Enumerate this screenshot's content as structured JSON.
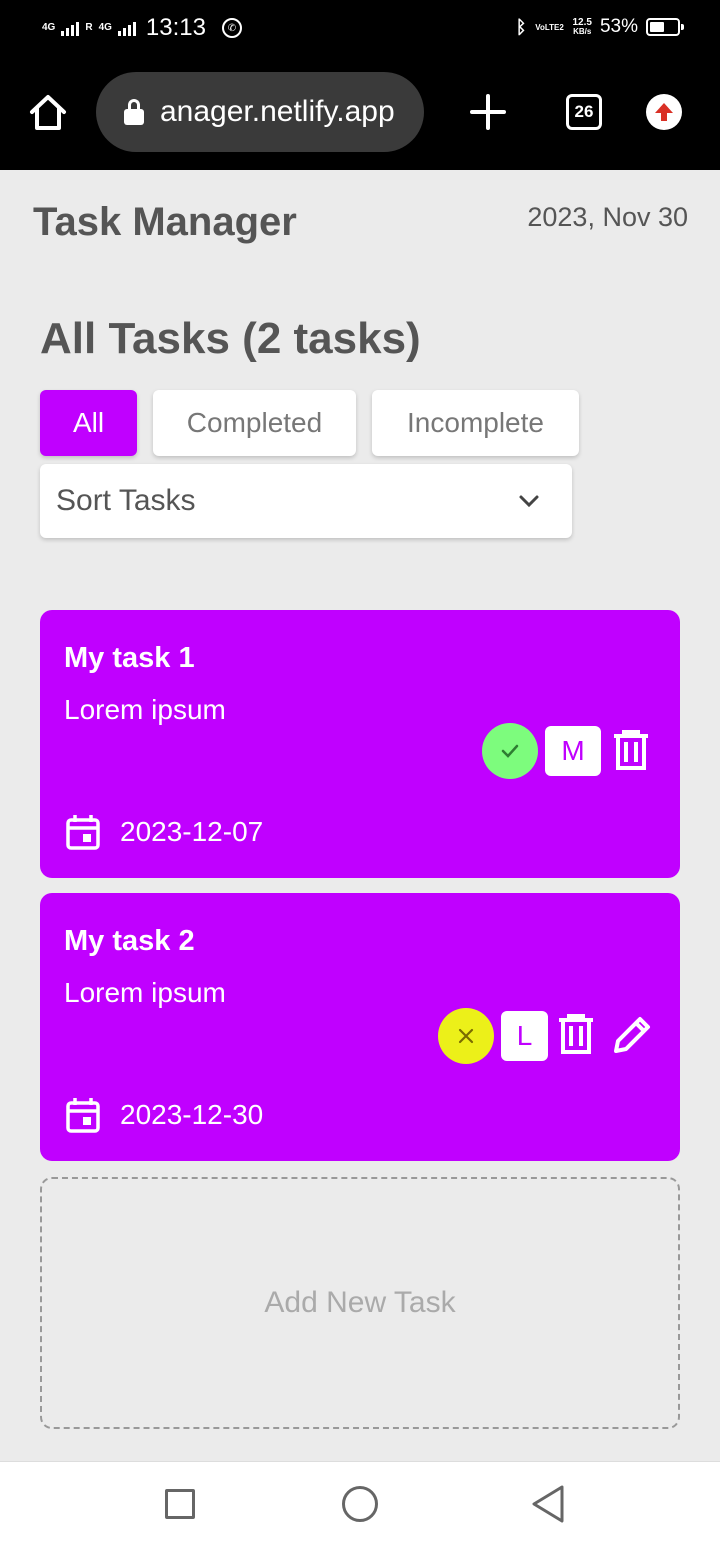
{
  "status_bar": {
    "network_left": "4G",
    "network_right": "4G",
    "roaming": "R",
    "time": "13:13",
    "volte": "VoLTE2",
    "speed_value": "12.5",
    "speed_unit": "KB/s",
    "battery_percent": "53%",
    "battery_level": 0.53
  },
  "browser": {
    "url": "anager.netlify.app",
    "tab_count": "26"
  },
  "app": {
    "title": "Task Manager",
    "date": "2023, Nov 30",
    "section_title": "All Tasks (2 tasks)",
    "accent_color": "#c000ff",
    "filters": [
      {
        "label": "All",
        "active": true
      },
      {
        "label": "Completed",
        "active": false
      },
      {
        "label": "Incomplete",
        "active": false
      }
    ],
    "sort_label": "Sort Tasks",
    "tasks": [
      {
        "title": "My task 1",
        "description": "Lorem ipsum",
        "date": "2023-12-07",
        "status": "completed",
        "status_color": "#7dfc7d",
        "priority": "M"
      },
      {
        "title": "My task 2",
        "description": "Lorem ipsum",
        "date": "2023-12-30",
        "status": "incomplete",
        "status_color": "#ecf019",
        "priority": "L"
      }
    ],
    "add_task_label": "Add New Task"
  }
}
